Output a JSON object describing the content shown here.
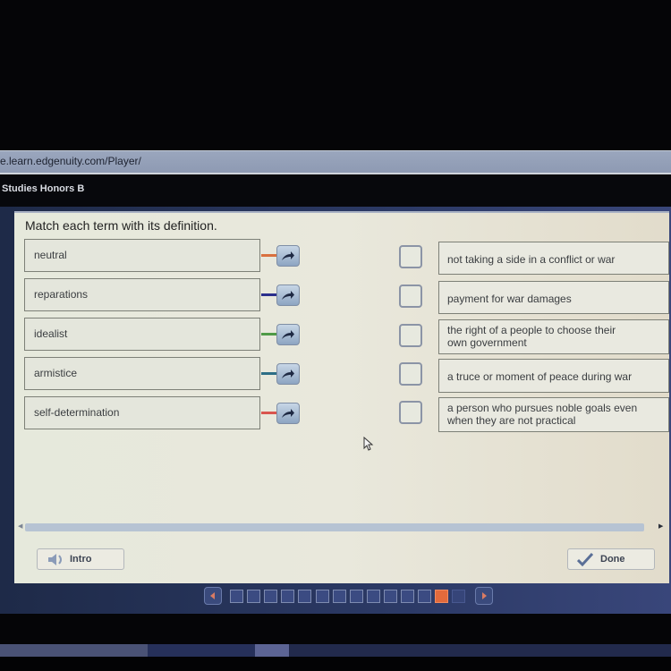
{
  "browser": {
    "url": "e.learn.edgenuity.com/Player/"
  },
  "course": {
    "title": "Studies Honors B"
  },
  "activity": {
    "instruction": "Match each term with its definition.",
    "terms": [
      {
        "label": "neutral",
        "connector_color": "#d9703f"
      },
      {
        "label": "reparations",
        "connector_color": "#2b2f8c"
      },
      {
        "label": "idealist",
        "connector_color": "#4f9a47"
      },
      {
        "label": "armistice",
        "connector_color": "#2d6e86"
      },
      {
        "label": "self-determination",
        "connector_color": "#d9554f"
      }
    ],
    "definitions": [
      {
        "line1": "not taking a side in a conflict or war",
        "line2": ""
      },
      {
        "line1": "payment for war damages",
        "line2": ""
      },
      {
        "line1": "the right of a people to choose their",
        "line2": "own government"
      },
      {
        "line1": "a truce or moment of peace during war",
        "line2": ""
      },
      {
        "line1": "a person who pursues noble goals even",
        "line2": "when they are not practical"
      }
    ],
    "icons": {
      "term_action": "arrow-right-curved-icon",
      "target": "empty-checkbox"
    }
  },
  "footer": {
    "intro_label": "Intro",
    "intro_icon": "speaker-icon",
    "done_label": "Done",
    "done_icon": "checkmark-icon"
  },
  "pager": {
    "total": 14,
    "current": 13,
    "states": [
      "visited",
      "visited",
      "visited",
      "visited",
      "visited",
      "visited",
      "visited",
      "visited",
      "visited",
      "visited",
      "visited",
      "visited",
      "current",
      "unvisited"
    ]
  },
  "colors": {
    "accent_current_page": "#e26a3c",
    "panel_bg": "#e6e9dc"
  }
}
